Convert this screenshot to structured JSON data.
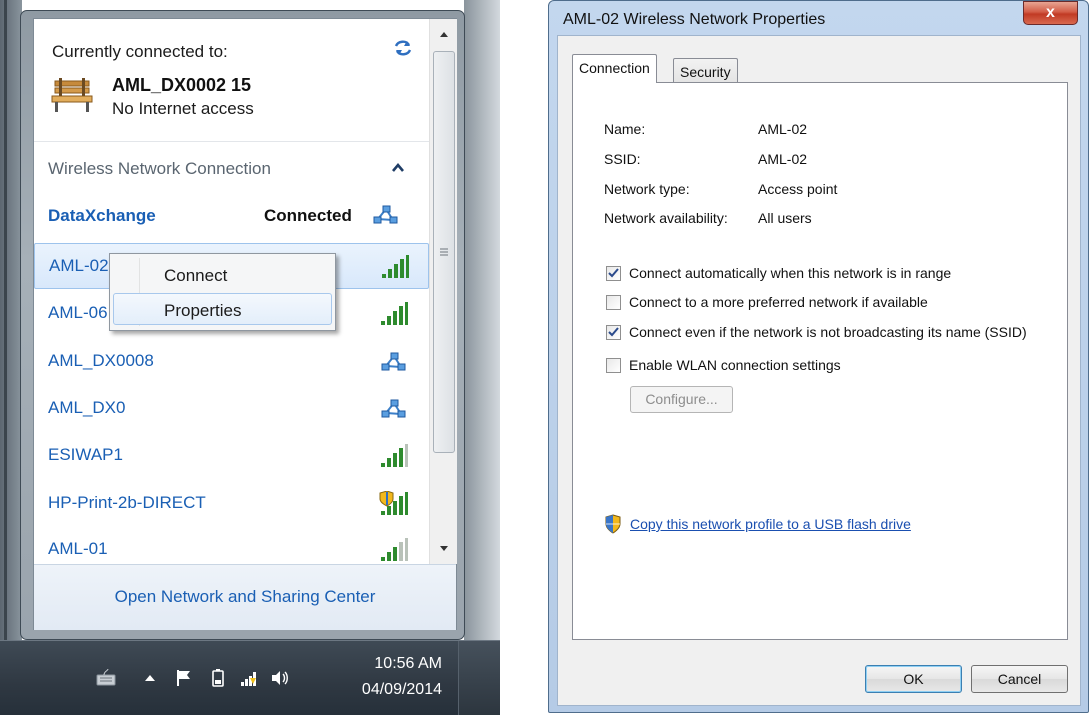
{
  "flyout": {
    "currently_connected_label": "Currently connected to:",
    "current_network_name": "AML_DX0002 15",
    "current_network_status": "No Internet access",
    "section_title": "Wireless Network Connection",
    "connected_network": {
      "name": "DataXchange",
      "status": "Connected"
    },
    "networks": [
      {
        "name": "AML-02",
        "icon": "wifi-signal-icon",
        "selected": true
      },
      {
        "name": "AML-06",
        "icon": "wifi-signal-icon",
        "selected": false
      },
      {
        "name": "AML_DX0008",
        "icon": "adhoc-network-icon",
        "selected": false
      },
      {
        "name": "AML_DX0",
        "icon": "adhoc-network-icon",
        "selected": false
      },
      {
        "name": "ESIWAP1",
        "icon": "wifi-signal-icon",
        "selected": false
      },
      {
        "name": "HP-Print-2b-DIRECT",
        "icon": "secured-wifi-icon",
        "selected": false
      },
      {
        "name": "AML-01",
        "icon": "wifi-signal-icon",
        "selected": false
      }
    ],
    "context_menu": {
      "items": [
        "Connect",
        "Properties"
      ],
      "hovered": "Properties"
    },
    "footer_link": "Open Network and Sharing Center"
  },
  "taskbar": {
    "time": "10:56 AM",
    "date": "04/09/2014",
    "tray_icons": [
      "keyboard-icon",
      "show-hidden-icons-icon",
      "action-center-flag-icon",
      "battery-icon",
      "network-signal-icon",
      "volume-icon"
    ]
  },
  "dialog": {
    "title": "AML-02 Wireless Network Properties",
    "close_label": "x",
    "tabs": [
      "Connection",
      "Security"
    ],
    "active_tab": "Connection",
    "properties": [
      {
        "label": "Name:",
        "value": "AML-02"
      },
      {
        "label": "SSID:",
        "value": "AML-02"
      },
      {
        "label": "Network type:",
        "value": "Access point"
      },
      {
        "label": "Network availability:",
        "value": "All users"
      }
    ],
    "options": [
      {
        "label": "Connect automatically when this network is in range",
        "checked": true
      },
      {
        "label": "Connect to a more preferred network if available",
        "checked": false
      },
      {
        "label": "Connect even if the network is not broadcasting its name (SSID)",
        "checked": true
      },
      {
        "label": "Enable WLAN connection settings",
        "checked": false
      }
    ],
    "configure_button": "Configure...",
    "copy_link": "Copy this network profile to a USB flash drive",
    "ok_button": "OK",
    "cancel_button": "Cancel"
  },
  "colors": {
    "link_blue": "#1a5fb4",
    "selected_row": "#dbe9fb",
    "taskbar": "#2f3842",
    "dialog_frame": "#b9cfe8",
    "close_red": "#c9452f"
  }
}
